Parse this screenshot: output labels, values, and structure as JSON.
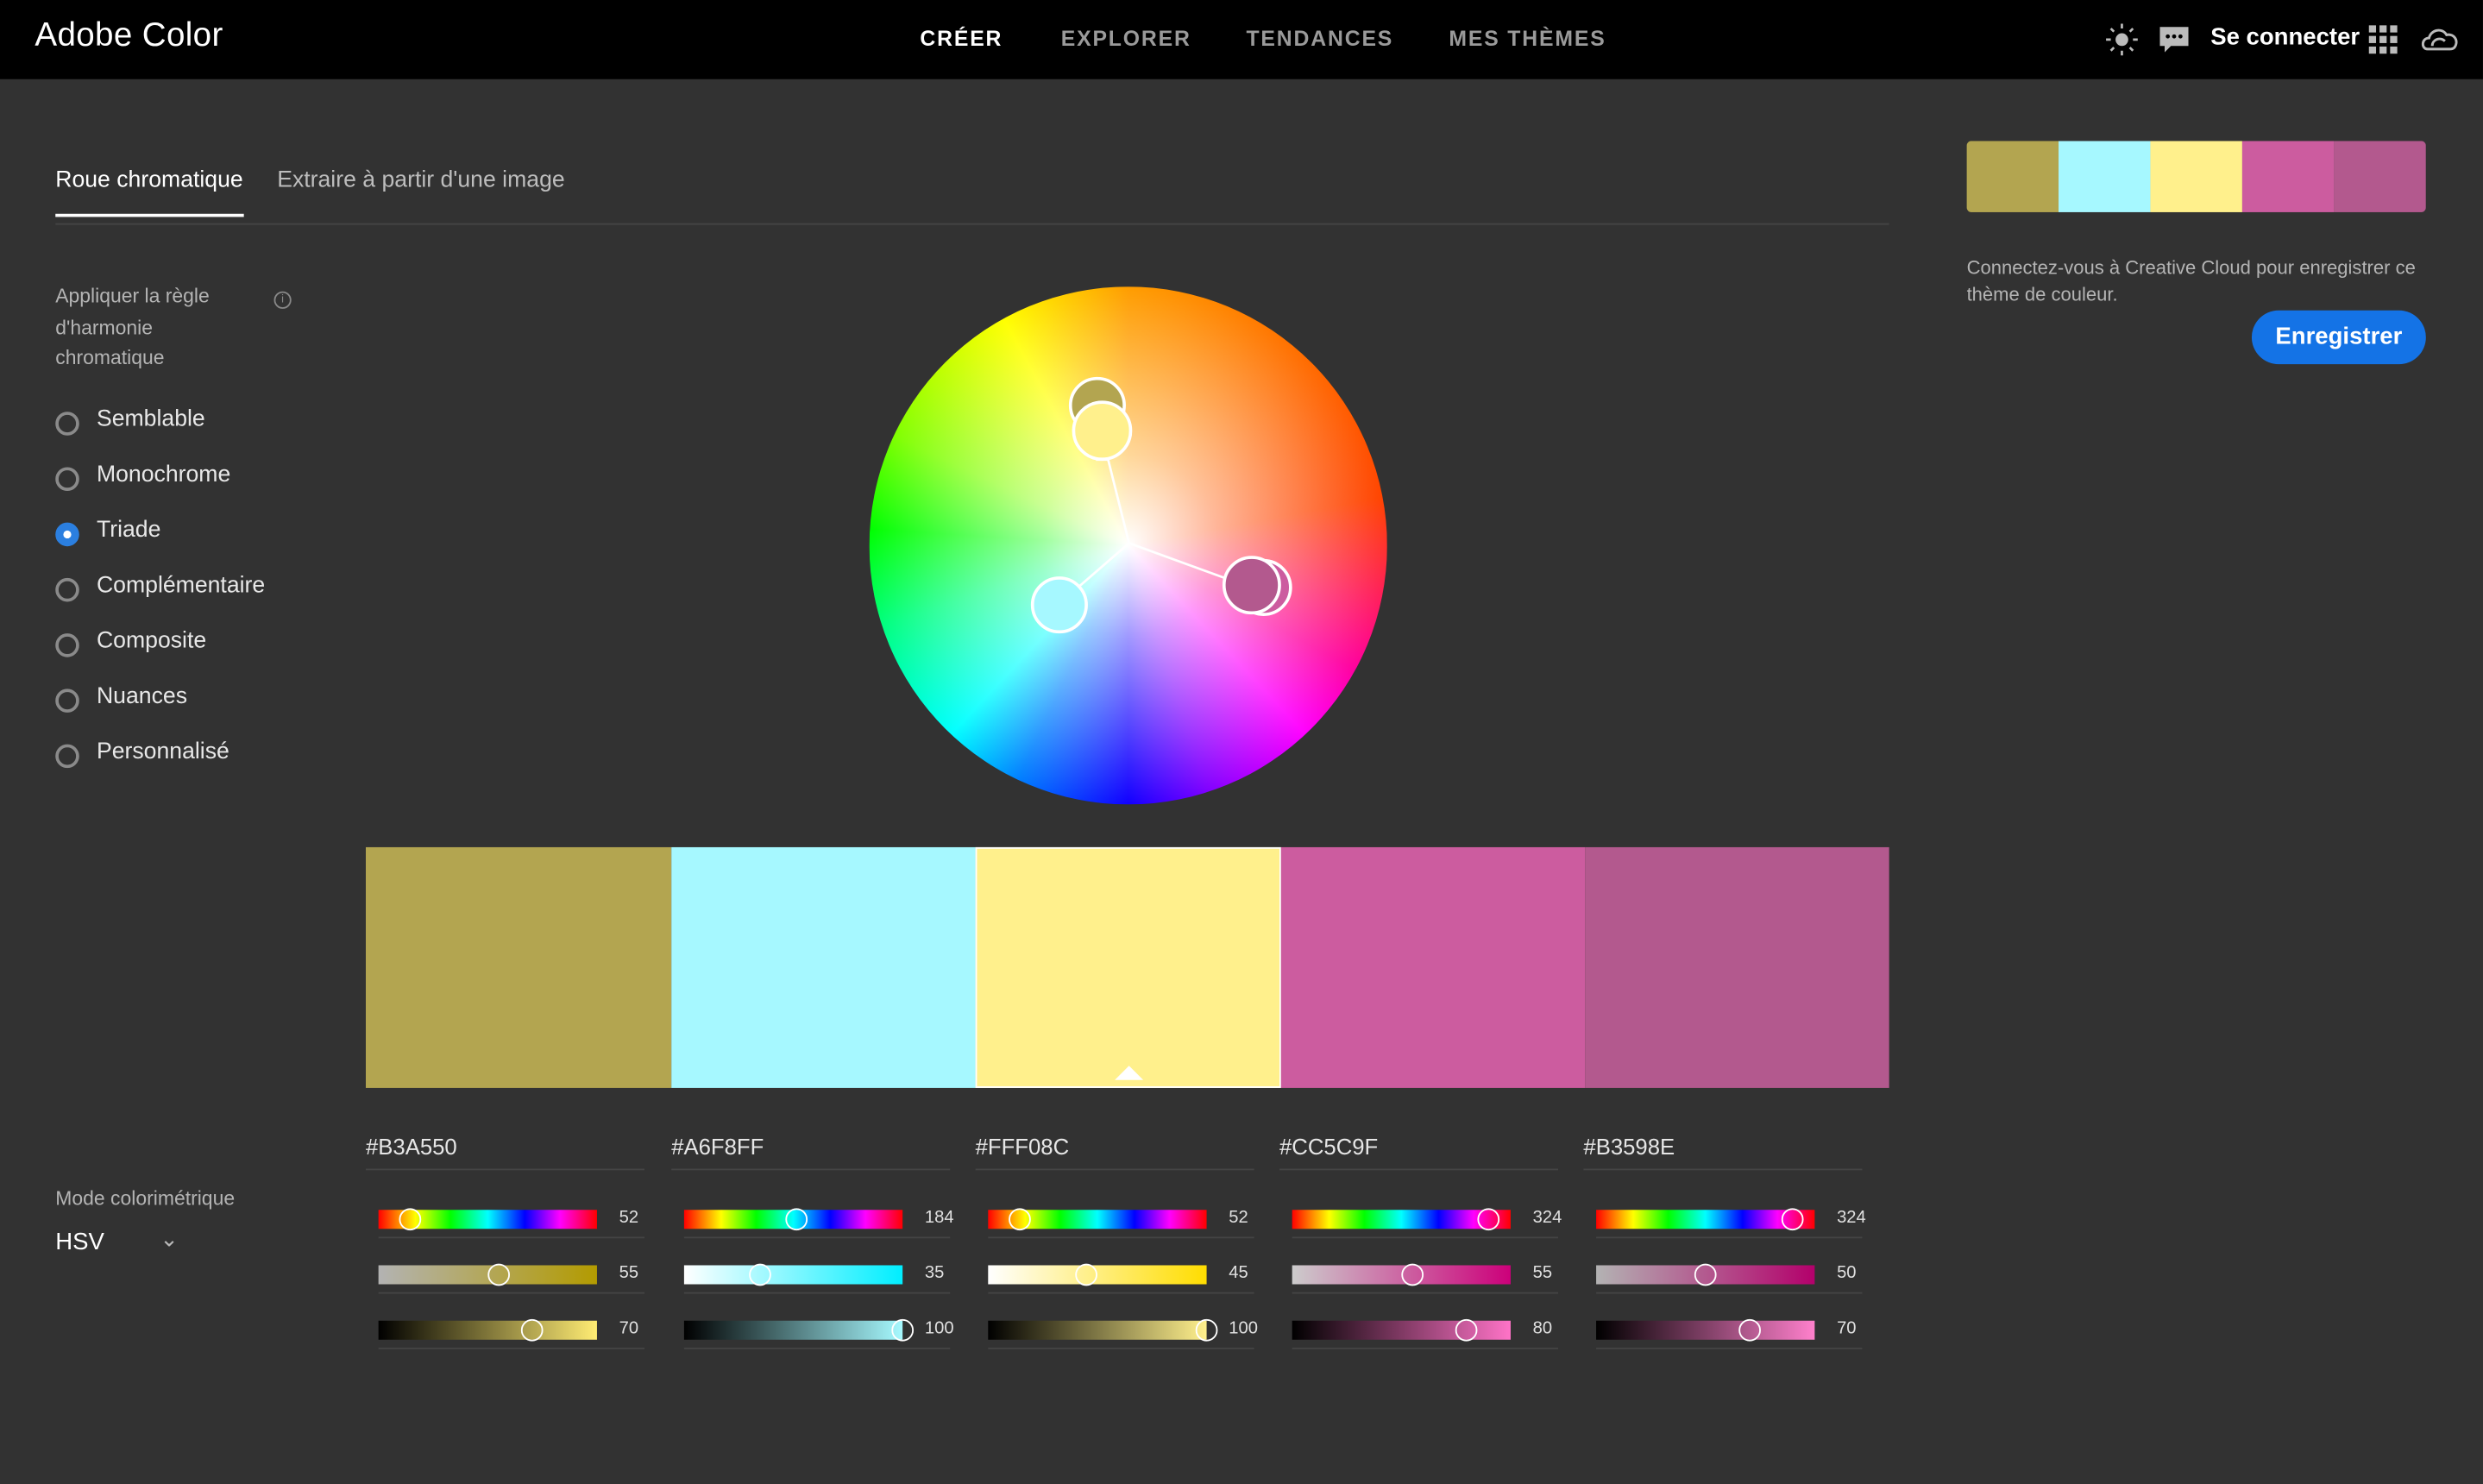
{
  "app": {
    "title": "Adobe Color"
  },
  "nav": {
    "items": [
      "CRÉER",
      "EXPLORER",
      "TENDANCES",
      "MES THÈMES"
    ],
    "active": "CRÉER"
  },
  "header": {
    "signin": "Se connecter",
    "icons": [
      "brightness-icon",
      "chat-icon",
      "apps-grid-icon",
      "creative-cloud-icon"
    ]
  },
  "tabs": {
    "items": [
      "Roue chromatique",
      "Extraire à partir d'une image"
    ],
    "active": "Roue chromatique"
  },
  "harmony": {
    "title": "Appliquer la règle d'harmonie chromatique",
    "options": [
      "Semblable",
      "Monochrome",
      "Triade",
      "Complémentaire",
      "Composite",
      "Nuances",
      "Personnalisé"
    ],
    "selected": "Triade"
  },
  "mode": {
    "label": "Mode colorimétrique",
    "value": "HSV"
  },
  "colors": [
    {
      "hex": "#B3A550",
      "h": "52",
      "s": "55",
      "v": "70",
      "selected": false
    },
    {
      "hex": "#A6F8FF",
      "h": "184",
      "s": "35",
      "v": "100",
      "selected": false
    },
    {
      "hex": "#FFF08C",
      "h": "52",
      "s": "45",
      "v": "100",
      "selected": true
    },
    {
      "hex": "#CC5C9F",
      "h": "324",
      "s": "55",
      "v": "80",
      "selected": false
    },
    {
      "hex": "#B3598E",
      "h": "324",
      "s": "50",
      "v": "70",
      "selected": false
    }
  ],
  "save": {
    "message": "Connectez-vous à Creative Cloud pour enregistrer ce thème de couleur.",
    "button": "Enregistrer"
  }
}
